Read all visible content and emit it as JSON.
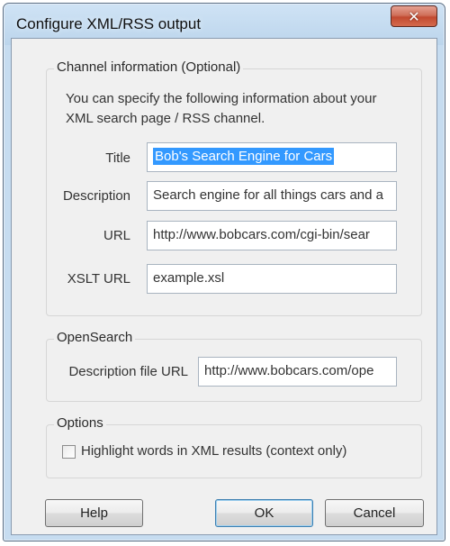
{
  "window": {
    "title": "Configure XML/RSS output",
    "close_glyph": "✕"
  },
  "channel": {
    "legend": "Channel information (Optional)",
    "intro_line1": "You can specify the following information about your",
    "intro_line2": "XML search page / RSS channel.",
    "title_label": "Title",
    "title_value": "Bob's Search Engine for Cars",
    "description_label": "Description",
    "description_value": "Search engine for all things cars and a",
    "url_label": "URL",
    "url_value": "http://www.bobcars.com/cgi-bin/sear",
    "xslt_label": "XSLT URL",
    "xslt_value": "example.xsl"
  },
  "opensearch": {
    "legend": "OpenSearch",
    "desc_file_label": "Description file URL",
    "desc_file_value": "http://www.bobcars.com/ope"
  },
  "options": {
    "legend": "Options",
    "highlight_label": "Highlight words in XML results (context only)",
    "highlight_checked": false
  },
  "buttons": {
    "help": "Help",
    "ok": "OK",
    "cancel": "Cancel"
  },
  "icons": {
    "close": "close-icon",
    "checkbox": "checkbox-unchecked"
  }
}
